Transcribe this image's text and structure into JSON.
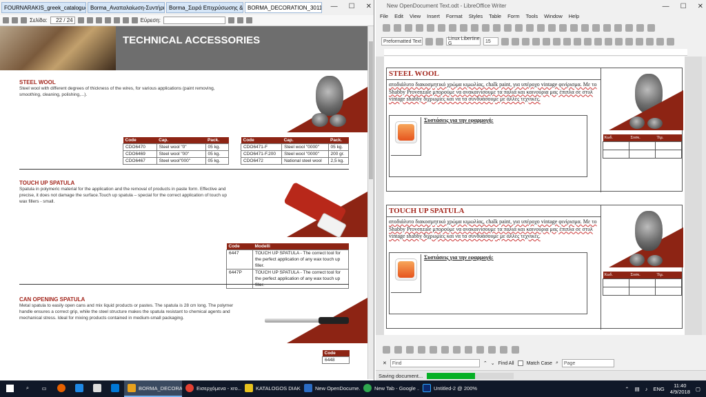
{
  "left_window": {
    "tabs": [
      {
        "label": "FOURNARAKIS_greek_catalogue..."
      },
      {
        "label": "Borma_Αναπαλαίωση-Συντήρησ..."
      },
      {
        "label": "Borma_Σειρά Επιχρύσωσης & Βε..."
      },
      {
        "label": "BORMA_DECORATION_3011201..."
      }
    ],
    "toolbar": {
      "page_label": "Σελίδα:",
      "page_value": "22 / 24",
      "find_label": "Εύρεση:"
    },
    "catalog": {
      "header_title": "TECHNICAL ACCESSORIES",
      "sections": [
        {
          "title": "STEEL WOOL",
          "desc": "Steel wool with different degrees of thickness of the wires, for various applications (paint removing, smoothing, cleaning, polishing,...).",
          "table1": {
            "headers": [
              "Code",
              "Cap.",
              "Pack."
            ],
            "rows": [
              [
                "CDO6470",
                "Steel wool \"0\"",
                "05 kg."
              ],
              [
                "CDO6469",
                "Steel wool \"00\"",
                "05 kg."
              ],
              [
                "CDO6467",
                "Steel wool\"000\"",
                "05 kg."
              ]
            ]
          },
          "table2": {
            "headers": [
              "Code",
              "Cap.",
              "Pack."
            ],
            "rows": [
              [
                "CDO6471-F",
                "Steel wool \"0000\"",
                "05 kg."
              ],
              [
                "CDO6471-F.200",
                "Steel wool \"0000\"",
                "200 gr."
              ],
              [
                "CDO6472",
                "National steel wool",
                "2,5 kg."
              ]
            ]
          }
        },
        {
          "title": "TOUCH UP SPATULA",
          "desc": "Spatula in polymeric material for the application and the removal of products in paste form. Effective and precise, it does not damage the surface.Touch up spatula – special for the correct application of touch up wax fillers - small.",
          "table": {
            "headers": [
              "Code",
              "Modelli"
            ],
            "rows": [
              [
                "6447",
                "TOUCH UP SPATULA - The correct tool for the perfect application of any wax touch up filler."
              ],
              [
                "6447P",
                "TOUCH UP SPATULA - The correct tool for the perfect application of any wax touch up filler."
              ]
            ]
          }
        },
        {
          "title": "CAN OPENING SPATULA",
          "desc": "Metal spatula to easily open cans and mix liquid  products or pastes. The spatula is 28 cm long. The polymer handle ensures a correct grip, while the steel structure makes the spatula resistant to chemical agents and mechanical stress. Ideal for mixing products contained in medium-small packaging.",
          "table": {
            "headers": [
              "Code"
            ],
            "rows": [
              [
                "6448"
              ]
            ]
          }
        }
      ]
    }
  },
  "right_window": {
    "title": "New OpenDocument Text.odt - LibreOffice Writer",
    "menu": [
      "File",
      "Edit",
      "View",
      "Insert",
      "Format",
      "Styles",
      "Table",
      "Form",
      "Tools",
      "Window",
      "Help"
    ],
    "paragraph_style": "Preformatted Text",
    "font_name": "Linux Libertine G",
    "font_size": "15",
    "doc_sections": [
      {
        "title": "STEEL WOOL",
        "text": "ατοδιάλυτο διακοσμητικό χρώμα κιμωλίας, chalk paint, για υπέροχο vintage φινίρισμα. Με το Shabby Provenzale μπορούμε να ανακαινίσουμε τα παλιά και καινούρια μας έπιπλα σε στυλ vintage shabby διχρωμίες και να τα συνδυάσουμε με άλλες τεχνικές.",
        "recommendation": "Συστάσεις για την εφαρμογή:",
        "table_headers": [
          "Κωδ.",
          "Συσκ.",
          "Τιμ."
        ]
      },
      {
        "title": "TOUCH UP SPATULA",
        "text": "ατοδιάλυτο διακοσμητικό χρώμα κιμωλίας, chalk paint, για υπέροχο vintage φινίρισμα. Με το Shabby Provenzale μπορούμε να ανακαινίσουμε τα παλιά και καινούρια μας έπιπλα σε στυλ vintage shabby διχρωμίες και να τα συνδυάσουμε με άλλες τεχνικές.",
        "recommendation": "Συστάσεις για την εφαρμογή:",
        "table_headers": [
          "Κωδ.",
          "Συσκ.",
          "Τιμ."
        ]
      }
    ],
    "find_bar": {
      "placeholder": "Find",
      "find_all": "Find All",
      "match_case": "Match Case",
      "search_type": "Page"
    },
    "status": {
      "text": "Saving document...",
      "progress": 0.55
    }
  },
  "taskbar": {
    "items": [
      {
        "label": "BORMA_DECORATI...",
        "color": "#e8a21d",
        "active": true
      },
      {
        "label": "Εισερχόμενα - xro...",
        "color": "#e34133",
        "active": false
      },
      {
        "label": "KATALOGOS DIAKO...",
        "color": "#e8c21d",
        "active": false
      },
      {
        "label": "New OpenDocume...",
        "color": "#2b6cc4",
        "active": false
      },
      {
        "label": "New Tab - Google ...",
        "color": "#2fa84f",
        "active": false
      },
      {
        "label": "Untitled-2 @ 200% ...",
        "color": "#0b2a6f",
        "active": false
      }
    ],
    "language": "ENG",
    "time": "11:40",
    "date": "4/9/2018"
  }
}
